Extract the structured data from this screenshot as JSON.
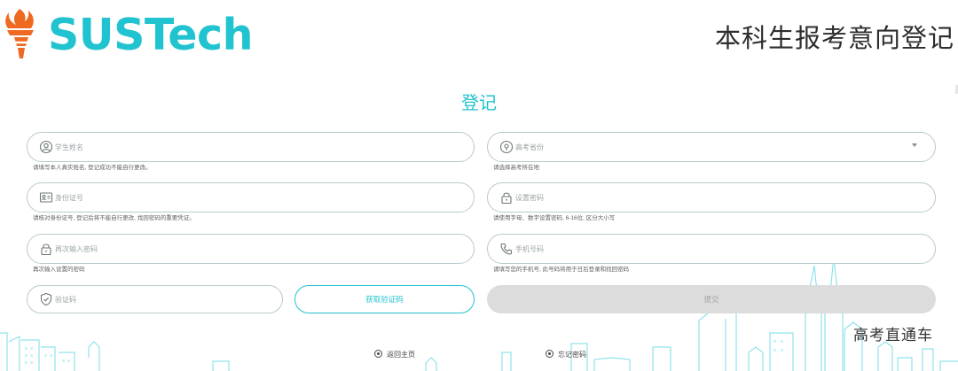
{
  "header": {
    "logo_text": "SUSTech",
    "page_title": "本科生报考意向登记"
  },
  "form": {
    "title": "登记",
    "fields": {
      "student_name": {
        "placeholder": "学生姓名",
        "hint": "请填写本人真实姓名, 登记成功不能自行更改。"
      },
      "exam_province": {
        "placeholder": "高考省份",
        "hint": "请选择高考所在地"
      },
      "id_number": {
        "placeholder": "身份证号",
        "hint": "请核对身份证号, 登记后将不能自行更改, 找回密码的重要凭证。"
      },
      "password": {
        "placeholder": "设置密码",
        "hint": "请使用字母、数字设置密码, 6-16位, 区分大小写"
      },
      "confirm_password": {
        "placeholder": "再次输入密码",
        "hint": "再次输入设置的密码"
      },
      "phone": {
        "placeholder": "手机号码",
        "hint": "请填写您的手机号, 此号码将用于日后登录和找回密码"
      },
      "captcha": {
        "placeholder": "验证码"
      }
    },
    "get_code_label": "获取验证码",
    "submit_label": "提交"
  },
  "footer": {
    "back_home_label": "返回主页",
    "forgot_password_label": "忘记密码"
  },
  "watermark": "高考直通车",
  "colors": {
    "accent": "#20c3cf",
    "disabled_button": "#dcdcdc",
    "logo_orange": "#ef6a21"
  }
}
